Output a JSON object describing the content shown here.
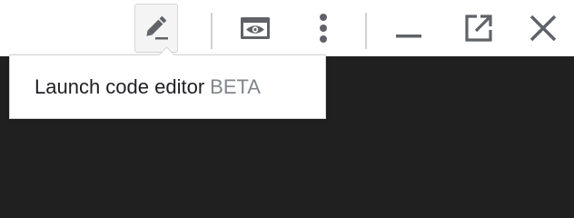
{
  "toolbar": {
    "buttons": [
      {
        "name": "launch-code-editor",
        "icon": "pencil-icon",
        "active": true
      },
      {
        "name": "preview",
        "icon": "preview-icon"
      },
      {
        "name": "more-options",
        "icon": "more-vert-icon"
      },
      {
        "name": "minimize",
        "icon": "minimize-icon"
      },
      {
        "name": "open-in-new-window",
        "icon": "open-in-new-icon"
      },
      {
        "name": "close",
        "icon": "close-icon"
      }
    ]
  },
  "tooltip": {
    "text": "Launch code editor",
    "badge": "BETA"
  },
  "colors": {
    "toolbar_background": "#ffffff",
    "icon_color": "#5f6368",
    "panel_background": "#202020",
    "badge_color": "#80868b"
  }
}
